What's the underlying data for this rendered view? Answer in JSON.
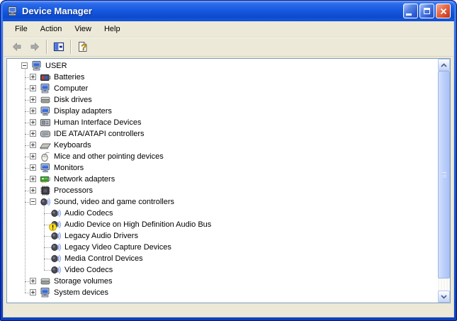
{
  "window": {
    "title": "Device Manager"
  },
  "menu": {
    "items": [
      "File",
      "Action",
      "View",
      "Help"
    ]
  },
  "toolbar": {
    "buttons": [
      "back-arrow",
      "forward-arrow",
      "show-console-tree",
      "help"
    ]
  },
  "tree": {
    "root_label": "USER",
    "items": [
      {
        "label": "USER",
        "level": 0,
        "expander": "minus",
        "icon": "computer",
        "overlay": null
      },
      {
        "label": "Batteries",
        "level": 1,
        "expander": "plus",
        "icon": "battery",
        "overlay": null
      },
      {
        "label": "Computer",
        "level": 1,
        "expander": "plus",
        "icon": "computer",
        "overlay": null
      },
      {
        "label": "Disk drives",
        "level": 1,
        "expander": "plus",
        "icon": "disk",
        "overlay": null
      },
      {
        "label": "Display adapters",
        "level": 1,
        "expander": "plus",
        "icon": "display",
        "overlay": null
      },
      {
        "label": "Human Interface Devices",
        "level": 1,
        "expander": "plus",
        "icon": "hid",
        "overlay": null
      },
      {
        "label": "IDE ATA/ATAPI controllers",
        "level": 1,
        "expander": "plus",
        "icon": "ide",
        "overlay": null
      },
      {
        "label": "Keyboards",
        "level": 1,
        "expander": "plus",
        "icon": "keyboard",
        "overlay": null
      },
      {
        "label": "Mice and other pointing devices",
        "level": 1,
        "expander": "plus",
        "icon": "mouse",
        "overlay": null
      },
      {
        "label": "Monitors",
        "level": 1,
        "expander": "plus",
        "icon": "monitor",
        "overlay": null
      },
      {
        "label": "Network adapters",
        "level": 1,
        "expander": "plus",
        "icon": "network",
        "overlay": null
      },
      {
        "label": "Processors",
        "level": 1,
        "expander": "plus",
        "icon": "processor",
        "overlay": null
      },
      {
        "label": "Sound, video and game controllers",
        "level": 1,
        "expander": "minus",
        "icon": "sound",
        "overlay": null
      },
      {
        "label": "Audio Codecs",
        "level": 2,
        "expander": null,
        "icon": "sound",
        "overlay": null
      },
      {
        "label": "Audio Device on High Definition Audio Bus",
        "level": 2,
        "expander": null,
        "icon": "sound",
        "overlay": "warning"
      },
      {
        "label": "Legacy Audio Drivers",
        "level": 2,
        "expander": null,
        "icon": "sound",
        "overlay": null
      },
      {
        "label": "Legacy Video Capture Devices",
        "level": 2,
        "expander": null,
        "icon": "sound",
        "overlay": null
      },
      {
        "label": "Media Control Devices",
        "level": 2,
        "expander": null,
        "icon": "sound",
        "overlay": null
      },
      {
        "label": "Video Codecs",
        "level": 2,
        "expander": null,
        "icon": "sound",
        "overlay": null
      },
      {
        "label": "Storage volumes",
        "level": 1,
        "expander": "plus",
        "icon": "disk",
        "overlay": null
      },
      {
        "label": "System devices",
        "level": 1,
        "expander": "plus",
        "icon": "computer",
        "overlay": null
      }
    ]
  },
  "colors": {
    "titlebar_blue": "#1558DE",
    "window_border_blue": "#0C42BE",
    "client_beige": "#ECE9D8",
    "warning_yellow": "#FFE01A",
    "tree_line_gray": "#9A9A9A",
    "panel_border": "#7F9DB9"
  }
}
